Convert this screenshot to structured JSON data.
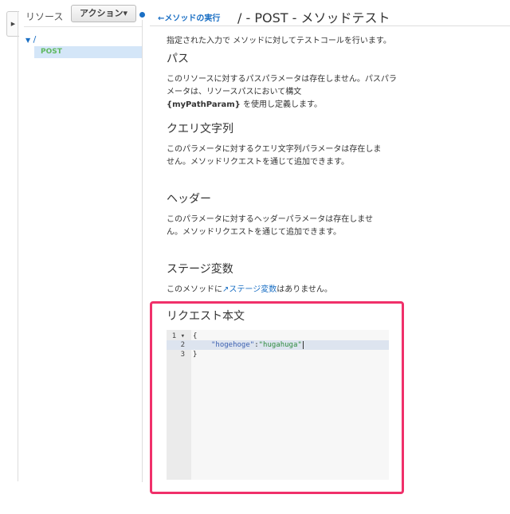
{
  "sidebar": {
    "title": "リソース",
    "action_button": "アクション▾",
    "tree": [
      {
        "label": "/",
        "children": [
          {
            "label": "POST"
          }
        ]
      }
    ]
  },
  "header": {
    "back_link": "メソッドの実行",
    "title": "/ - POST - メソッドテスト"
  },
  "main": {
    "intro": "指定された入力で メソッドに対してテストコールを行います。",
    "path_heading": "パス",
    "path_text_1": "このリソースに対するパスパラメータは存在しません。パスパラメータは、リソースパスにおいて構文",
    "path_param": "{myPathParam}",
    "path_text_2": " を使用し定義します。",
    "query_heading": "クエリ文字列",
    "query_text": "このパラメータに対するクエリ文字列パラメータは存在しません。メソッドリクエストを通じて追加できます。",
    "header_heading": "ヘッダー",
    "header_text": "このパラメータに対するヘッダーパラメータは存在しません。メソッドリクエストを通じて追加できます。",
    "stage_heading": "ステージ変数",
    "stage_text_1": "このメソッドに",
    "stage_link": "ステージ変数",
    "stage_text_2": "はありません。",
    "body_heading": "リクエスト本文"
  },
  "editor": {
    "line_numbers": [
      "1 ▾",
      "2",
      "3"
    ],
    "lines": [
      "{",
      "}"
    ],
    "key": "\"hogehoge\"",
    "colon": ":",
    "value": "\"hugahuga\""
  },
  "colors": {
    "highlight": "#f0306a",
    "link": "#1a6fc4"
  }
}
